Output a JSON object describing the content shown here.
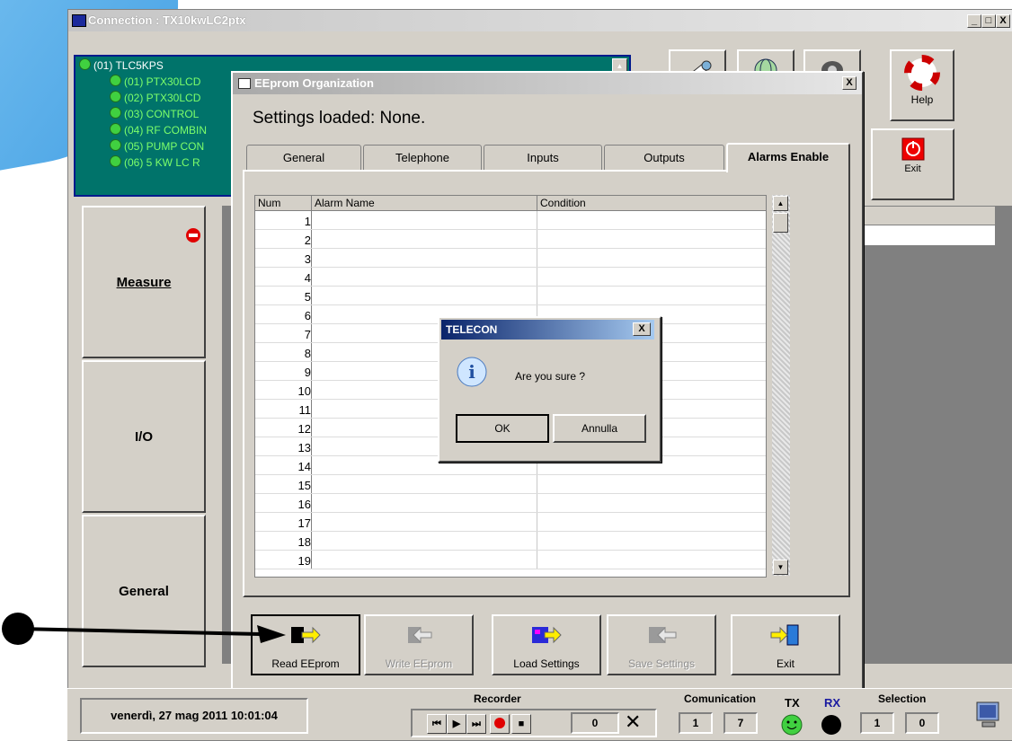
{
  "main_window": {
    "title": "Connection : TX10kwLC2ptx",
    "controls": [
      "_",
      "□",
      "X"
    ]
  },
  "tree": {
    "root": "(01) TLC5KPS",
    "items": [
      "(01) PTX30LCD",
      "(02) PTX30LCD",
      "(03) CONTROL",
      "(04) RF COMBIN",
      "(05) PUMP CON",
      "(06) 5 KW LC R"
    ]
  },
  "toolbar": {
    "help_label": "Help",
    "exit_label": "Exit"
  },
  "left_nav": {
    "measure": "Measure",
    "io": "I/O",
    "general": "General"
  },
  "eeprom_dialog": {
    "title": "EEprom Organization",
    "close": "X",
    "settings_loaded": "Settings loaded:  None.",
    "tabs": [
      "General",
      "Telephone",
      "Inputs",
      "Outputs",
      "Alarms Enable"
    ],
    "active_tab": "Alarms Enable",
    "grid": {
      "headers": [
        "Num",
        "Alarm Name",
        "Condition"
      ],
      "rows": [
        "1",
        "2",
        "3",
        "4",
        "5",
        "6",
        "7",
        "8",
        "9",
        "10",
        "11",
        "12",
        "13",
        "14",
        "15",
        "16",
        "17",
        "18",
        "19"
      ]
    },
    "buttons": {
      "read": "Read EEprom",
      "write": "Write EEprom",
      "load": "Load Settings",
      "save": "Save Settings",
      "exit": "Exit"
    }
  },
  "message_box": {
    "title": "TELECON",
    "close": "X",
    "message": "Are you sure ?",
    "ok": "OK",
    "cancel": "Annulla"
  },
  "status_bar": {
    "datetime": "venerdì, 27 mag 2011  10:01:04",
    "recorder_label": "Recorder",
    "recorder_value": "0",
    "communication_label": "Comunication",
    "comm_values": [
      "1",
      "7"
    ],
    "tx_label": "TX",
    "rx_label": "RX",
    "selection_label": "Selection",
    "selection_values": [
      "1",
      "0"
    ]
  },
  "colors": {
    "accent_blue": "#2f95e0",
    "tree_bg": "#00736a",
    "dialog_bg": "#d4d0c8",
    "stop_red": "#e00000"
  }
}
